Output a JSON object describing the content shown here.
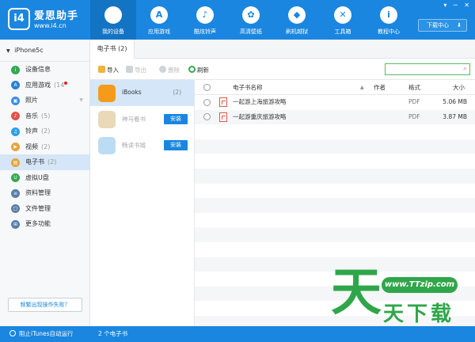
{
  "brand": {
    "logo_text": "i4",
    "name": "爱思助手",
    "url": "www.i4.cn"
  },
  "nav": [
    {
      "label": "我的设备",
      "icon": "apple-icon",
      "active": true
    },
    {
      "label": "应用游戏",
      "icon": "app-store-icon"
    },
    {
      "label": "酷炫铃声",
      "icon": "bell-icon"
    },
    {
      "label": "高清壁纸",
      "icon": "flower-icon"
    },
    {
      "label": "刷机越狱",
      "icon": "dropbox-icon"
    },
    {
      "label": "工具箱",
      "icon": "tools-icon"
    },
    {
      "label": "教程中心",
      "icon": "info-icon"
    }
  ],
  "window_controls": "▾ ─ ✕",
  "download_center": "下载中心",
  "device": "iPhone5c",
  "sidebar": [
    {
      "label": "设备信息",
      "count": "",
      "color": "#34a853",
      "glyph": "i",
      "icon": "device-info-icon"
    },
    {
      "label": "应用游戏",
      "count": "(14",
      "color": "#2b7fd8",
      "glyph": "A",
      "icon": "app-icon",
      "dot": true
    },
    {
      "label": "照片",
      "count": "",
      "color": "#3a8ee6",
      "glyph": "▣",
      "icon": "photo-icon",
      "chevron": true
    },
    {
      "label": "音乐",
      "count": "(5)",
      "color": "#e2534b",
      "glyph": "♪",
      "icon": "music-icon"
    },
    {
      "label": "铃声",
      "count": "(2)",
      "color": "#2b9fe8",
      "glyph": "♫",
      "icon": "ringtone-icon"
    },
    {
      "label": "视频",
      "count": "(2)",
      "color": "#e8a33a",
      "glyph": "▶",
      "icon": "video-icon"
    },
    {
      "label": "电子书",
      "count": "(2)",
      "color": "#e8a33a",
      "glyph": "▤",
      "icon": "ebook-icon",
      "active": true
    },
    {
      "label": "虚拟U盘",
      "count": "",
      "color": "#34a853",
      "glyph": "U",
      "icon": "udisk-icon"
    },
    {
      "label": "资料管理",
      "count": "",
      "color": "#5a7fa8",
      "glyph": "≡",
      "icon": "data-manage-icon"
    },
    {
      "label": "文件管理",
      "count": "",
      "color": "#5a7fa8",
      "glyph": "▢",
      "icon": "file-manage-icon"
    },
    {
      "label": "更多功能",
      "count": "",
      "color": "#5a7fa8",
      "glyph": "⊞",
      "icon": "more-icon"
    }
  ],
  "fail_button": "频繁出现操作失败？",
  "tab": {
    "label": "电子书 (2)"
  },
  "toolbar": {
    "import": "导入",
    "export": "导出",
    "delete": "删除",
    "refresh": "刷新"
  },
  "search": {
    "placeholder": ""
  },
  "apps": [
    {
      "name": "iBooks",
      "count": "(2)",
      "color": "#f59b1c",
      "active": true
    },
    {
      "name": "神马看书",
      "install": "安装",
      "color": "#e9d9b8"
    },
    {
      "name": "畅读书城",
      "install": "安装",
      "color": "#bcdcf4"
    }
  ],
  "table": {
    "headers": {
      "name": "电子书名称",
      "author": "作者",
      "format": "格式",
      "size": "大小"
    },
    "rows": [
      {
        "name": "一起游上海旅游攻略",
        "author": "",
        "format": "PDF",
        "size": "5.06 MB"
      },
      {
        "name": "一起游重庆旅游攻略",
        "author": "",
        "format": "PDF",
        "size": "3.87 MB"
      }
    ],
    "empty_rows": 14
  },
  "watermark": {
    "url": "www.TTzip.com",
    "big": "天",
    "small": "天下载"
  },
  "status": {
    "itunes": "阻止iTunes自动运行",
    "count": "2 个电子书"
  }
}
